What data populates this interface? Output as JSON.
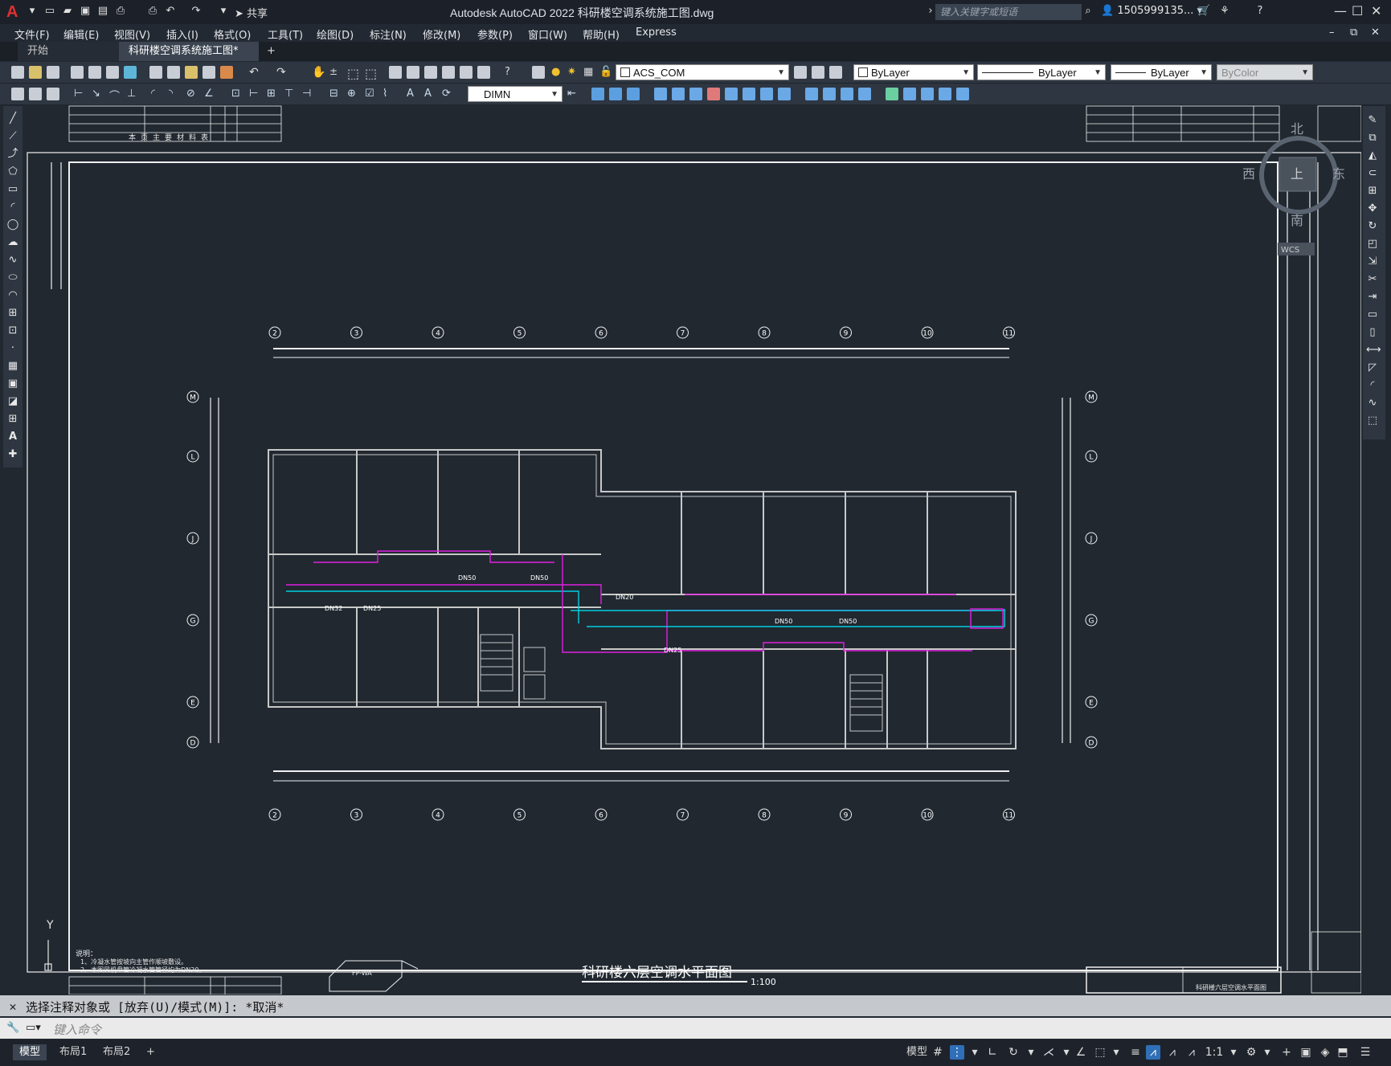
{
  "app": {
    "title": "Autodesk AutoCAD 2022    科研楼空调系统施工图.dwg",
    "logo": "A",
    "share_label": "共享",
    "search_placeholder": "键入关键字或短语",
    "user": "1505999135..."
  },
  "menu": [
    "文件(F)",
    "编辑(E)",
    "视图(V)",
    "插入(I)",
    "格式(O)",
    "工具(T)",
    "绘图(D)",
    "标注(N)",
    "修改(M)",
    "参数(P)",
    "窗口(W)",
    "帮助(H)",
    "Express"
  ],
  "tabs": [
    {
      "label": "开始",
      "active": false
    },
    {
      "label": "科研楼空调系统施工图*",
      "active": true
    }
  ],
  "toolbar": {
    "layer": "ACS_COM",
    "color": "ByLayer",
    "linetype": "ByLayer",
    "lineweight": "ByLayer",
    "plotstyle": "ByColor",
    "dimstyle": "DIMN"
  },
  "viewcube": {
    "north": "北",
    "south": "南",
    "east": "东",
    "west": "西",
    "top": "上",
    "wcs": "WCS"
  },
  "drawing": {
    "title": "科研楼六层空调水平面图",
    "scale": "1:100",
    "axis_numbers": [
      "2",
      "3",
      "4",
      "5",
      "6",
      "7",
      "8",
      "9",
      "10",
      "11"
    ],
    "axis_letters": [
      "M",
      "L",
      "J",
      "G",
      "E",
      "D"
    ],
    "pipe_labels": [
      "DN32",
      "DN25",
      "DN50",
      "DN50",
      "DN25",
      "DN50",
      "DN50",
      "DN20"
    ],
    "table_header": "本页主要材料表",
    "note_title": "说明：",
    "note_lines": [
      "1、冷凝水管按坡向主管作顺坡敷设。",
      "2、本图风机盘管冷凝水管管径均为DN20。"
    ],
    "fp_label": "FP-WA",
    "frame_title": "科研楼六层空调水平面图"
  },
  "command": {
    "history": "选择注释对象或 [放弃(U)/模式(M)]: *取消*",
    "placeholder": "键入命令"
  },
  "status": {
    "layouts": [
      "模型",
      "布局1",
      "布局2"
    ],
    "model": "模型",
    "scale": "1:1"
  }
}
